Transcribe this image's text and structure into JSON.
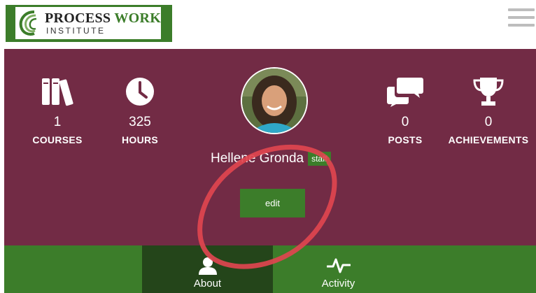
{
  "logo": {
    "line1_a": "PROCESS",
    "line1_b": "WORK",
    "line2": "INSTITUTE"
  },
  "header": {
    "menu_icon": "hamburger-menu-icon"
  },
  "stats": {
    "courses": {
      "value": "1",
      "label": "COURSES",
      "icon": "books-icon"
    },
    "hours": {
      "value": "325",
      "label": "HOURS",
      "icon": "clock-icon"
    },
    "posts": {
      "value": "0",
      "label": "POSTS",
      "icon": "chat-bubbles-icon"
    },
    "achievements": {
      "value": "0",
      "label": "ACHIEVEMENTS",
      "icon": "trophy-icon"
    }
  },
  "profile": {
    "name": "Hellene Gronda",
    "badge": "staff",
    "edit_label": "edit"
  },
  "tabs": [
    {
      "label": "About",
      "icon": "person-icon",
      "active": true
    },
    {
      "label": "Activity",
      "icon": "activity-pulse-icon",
      "active": false
    }
  ],
  "colors": {
    "brand_green": "#3c7d2a",
    "profile_bg": "#722b45",
    "active_tab": "#24451a",
    "annotation_red": "#e0454f"
  }
}
